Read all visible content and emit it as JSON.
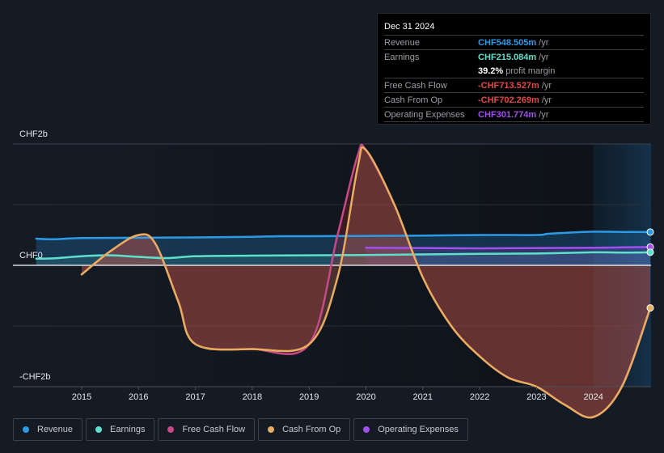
{
  "tooltip": {
    "date": "Dec 31 2024",
    "rows": [
      {
        "label": "Revenue",
        "value": "CHF548.505m",
        "unit": "/yr",
        "color": "#2d9ae5"
      },
      {
        "label": "Earnings",
        "value": "CHF215.084m",
        "unit": "/yr",
        "color": "#5fe0cd"
      },
      {
        "label": "",
        "value": "39.2%",
        "unit": "profit margin",
        "color": "#ffffff"
      },
      {
        "label": "Free Cash Flow",
        "value": "-CHF713.527m",
        "unit": "/yr",
        "color": "#e64545"
      },
      {
        "label": "Cash From Op",
        "value": "-CHF702.269m",
        "unit": "/yr",
        "color": "#e64545"
      },
      {
        "label": "Operating Expenses",
        "value": "CHF301.774m",
        "unit": "/yr",
        "color": "#a24ff0"
      }
    ]
  },
  "legend": [
    {
      "label": "Revenue",
      "color": "#2d9ae5"
    },
    {
      "label": "Earnings",
      "color": "#5fe0cd"
    },
    {
      "label": "Free Cash Flow",
      "color": "#c74a87"
    },
    {
      "label": "Cash From Op",
      "color": "#e8ad5f"
    },
    {
      "label": "Operating Expenses",
      "color": "#a24ff0"
    }
  ],
  "chart_data": {
    "type": "line",
    "title": "",
    "xlabel": "",
    "ylabel": "",
    "y_tick_labels": [
      "CHF2b",
      "CHF0",
      "-CHF2b"
    ],
    "y_ticks": [
      2000,
      0,
      -2000
    ],
    "ylim": [
      -2000,
      2000
    ],
    "x_tick_labels": [
      "2015",
      "2016",
      "2017",
      "2018",
      "2019",
      "2020",
      "2021",
      "2022",
      "2023",
      "2024"
    ],
    "x_ticks": [
      2015,
      2016,
      2017,
      2018,
      2019,
      2020,
      2021,
      2022,
      2023,
      2024
    ],
    "xlim": [
      2013.75,
      2025.0
    ],
    "grid": true,
    "highlight_region": [
      2024.0,
      2025.0
    ],
    "units": "CHF millions",
    "series": [
      {
        "name": "Revenue",
        "color": "#2d9ae5",
        "x": [
          2014.2,
          2014.5,
          2015.0,
          2016.0,
          2017.0,
          2018.0,
          2018.5,
          2019.0,
          2020.0,
          2021.0,
          2022.0,
          2023.0,
          2023.2,
          2023.6,
          2024.0,
          2024.5,
          2025.0
        ],
        "values": [
          440,
          430,
          450,
          455,
          460,
          470,
          480,
          480,
          485,
          490,
          500,
          500,
          520,
          540,
          555,
          550,
          548.5
        ]
      },
      {
        "name": "Earnings",
        "color": "#5fe0cd",
        "x": [
          2014.2,
          2014.5,
          2015.0,
          2015.5,
          2016.0,
          2016.5,
          2017.0,
          2018.0,
          2019.0,
          2020.0,
          2021.0,
          2022.0,
          2023.0,
          2024.0,
          2024.5,
          2025.0
        ],
        "values": [
          110,
          115,
          150,
          165,
          140,
          120,
          150,
          160,
          165,
          170,
          180,
          190,
          195,
          215,
          210,
          215.1
        ]
      },
      {
        "name": "Free Cash Flow",
        "color": "#c74a87",
        "x": [
          2015.0,
          2015.5,
          2016.0,
          2016.3,
          2016.7,
          2017.0,
          2018.0,
          2019.0,
          2019.5,
          2019.85,
          2020.0,
          2020.5,
          2021.0,
          2021.5,
          2022.0,
          2022.5,
          2023.0,
          2023.5,
          2024.0,
          2024.5,
          2025.0
        ],
        "values": [
          -150,
          230,
          500,
          350,
          -600,
          -1300,
          -1380,
          -1300,
          500,
          1800,
          1900,
          1000,
          -200,
          -1000,
          -1500,
          -1850,
          -2000,
          -2300,
          -2500,
          -2000,
          -713.5
        ]
      },
      {
        "name": "Cash From Op",
        "color": "#e8ad5f",
        "x": [
          2015.0,
          2015.5,
          2016.0,
          2016.3,
          2016.7,
          2017.0,
          2018.0,
          2019.0,
          2019.5,
          2019.85,
          2020.0,
          2020.5,
          2021.0,
          2021.5,
          2022.0,
          2022.5,
          2023.0,
          2023.5,
          2024.0,
          2024.5,
          2025.0
        ],
        "values": [
          -150,
          230,
          500,
          350,
          -600,
          -1300,
          -1380,
          -1300,
          -200,
          1600,
          1900,
          1000,
          -200,
          -1000,
          -1500,
          -1850,
          -2000,
          -2300,
          -2500,
          -2000,
          -702.3
        ]
      },
      {
        "name": "Operating Expenses",
        "color": "#a24ff0",
        "x": [
          2020.0,
          2021.0,
          2022.0,
          2023.0,
          2024.0,
          2025.0
        ],
        "values": [
          290,
          285,
          280,
          285,
          290,
          301.8
        ]
      }
    ]
  }
}
